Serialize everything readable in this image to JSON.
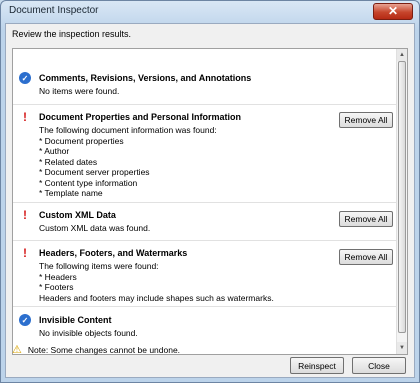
{
  "window": {
    "title": "Document Inspector",
    "close_glyph": "✕"
  },
  "subtitle": "Review the inspection results.",
  "sections": [
    {
      "status": "check-icon",
      "title": "Comments, Revisions, Versions, and Annotations",
      "description": "No items were found.",
      "button": ""
    },
    {
      "status": "warning-icon",
      "title": "Document Properties and Personal Information",
      "description": "The following document information was found:\n* Document properties\n* Author\n* Related dates\n* Document server properties\n* Content type information\n* Template name",
      "button": "Remove All"
    },
    {
      "status": "warning-icon",
      "title": "Custom XML Data",
      "description": "Custom XML data was found.",
      "button": "Remove All"
    },
    {
      "status": "warning-icon",
      "title": "Headers, Footers, and Watermarks",
      "description": "The following items were found:\n* Headers\n* Footers\nHeaders and footers may include shapes such as watermarks.",
      "button": "Remove All"
    },
    {
      "status": "check-icon",
      "title": "Invisible Content",
      "description": "No invisible objects found.",
      "button": ""
    }
  ],
  "footer": {
    "note": "Note: Some changes cannot be undone.",
    "reinspect_label": "Reinspect",
    "close_label": "Close"
  },
  "icons": {
    "check": "✓",
    "warning": "!",
    "triangle": "⚠"
  }
}
